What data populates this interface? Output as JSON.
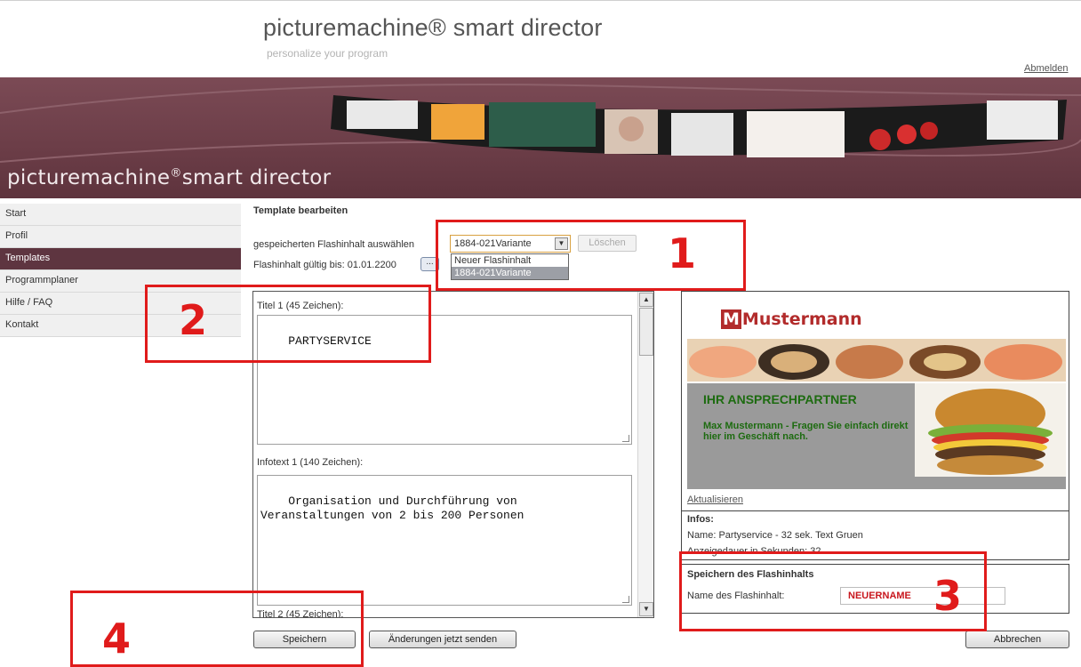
{
  "header": {
    "title": "picturemachine® smart director",
    "subtitle": "personalize your program",
    "logout_label": "Abmelden"
  },
  "banner": {
    "logo_main": "picturemachine",
    "logo_reg": "®",
    "logo_rest": "smart director"
  },
  "sidebar": {
    "items": [
      {
        "label": "Start",
        "active": false
      },
      {
        "label": "Profil",
        "active": false
      },
      {
        "label": "Templates",
        "active": true
      },
      {
        "label": "Programmplaner",
        "active": false
      },
      {
        "label": "Hilfe / FAQ",
        "active": false
      },
      {
        "label": "Kontakt",
        "active": false
      }
    ]
  },
  "main": {
    "heading": "Template bearbeiten",
    "select_label": "gespeicherten Flashinhalt auswählen",
    "selected_value": "1884-021Variante",
    "dropdown_options": [
      "Neuer Flashinhalt",
      "1884-021Variante"
    ],
    "delete_label": "Löschen",
    "valid_label": "Flashinhalt gültig bis: 01.01.2200",
    "date_button": "..."
  },
  "form": {
    "title1_label": "Titel 1 (45 Zeichen):",
    "title1_value": "PARTYSERVICE",
    "info1_label": "Infotext 1 (140 Zeichen):",
    "info1_value": "Organisation und Durchführung von\nVeranstaltungen von 2 bis 200 Personen",
    "title2_label": "Titel 2 (45 Zeichen):"
  },
  "preview": {
    "brand": "Mustermann",
    "brand_m": "M",
    "contact_title": "IHR ANSPRECHPARTNER",
    "contact_text": "Max Mustermann - Fragen Sie einfach direkt hier im Geschäft nach.",
    "refresh_label": "Aktualisieren"
  },
  "infos": {
    "heading": "Infos:",
    "name": "Name: Partyservice - 32 sek. Text Gruen",
    "duration": "Anzeigedauer in Sekunden: 32"
  },
  "save": {
    "heading": "Speichern des Flashinhalts",
    "name_label": "Name des Flashinhalt:",
    "name_value": "NEUERNAME"
  },
  "buttons": {
    "save": "Speichern",
    "send": "Änderungen jetzt senden",
    "cancel": "Abbrechen"
  },
  "annotations": [
    "1",
    "2",
    "3",
    "4"
  ],
  "colors": {
    "accent": "#5e3540",
    "annotation": "#e01b1b",
    "contact_green": "#1d6b10",
    "brand_red": "#b22b2b"
  }
}
